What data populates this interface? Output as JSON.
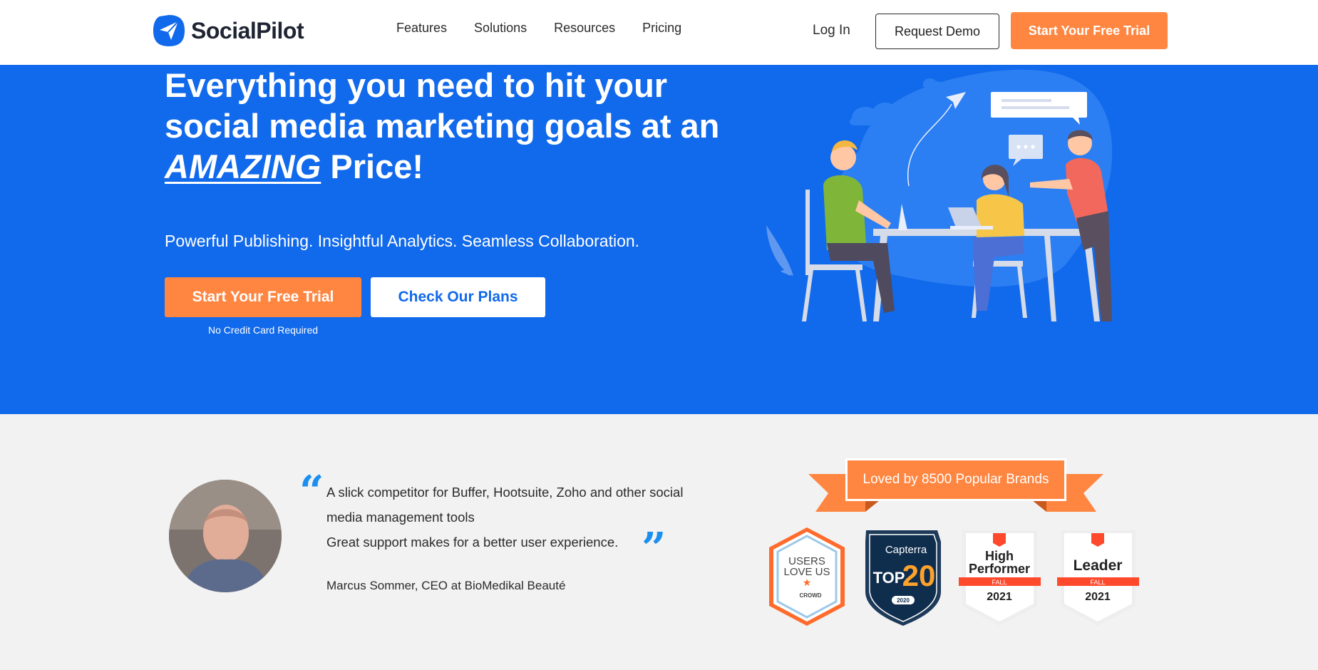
{
  "header": {
    "logo_text": "SocialPilot",
    "nav": [
      "Features",
      "Solutions",
      "Resources",
      "Pricing"
    ],
    "login": "Log In",
    "demo_button": "Request Demo",
    "trial_button": "Start Your Free Trial"
  },
  "hero": {
    "title_line1": "Everything you need to hit your",
    "title_line2": "social media marketing goals at an",
    "title_emph": "AMAZING",
    "title_end": " Price!",
    "subtitle": "Powerful Publishing. Insightful Analytics. Seamless Collaboration.",
    "trial_button": "Start Your Free Trial",
    "plans_button": "Check Our Plans",
    "no_card": "No Credit Card Required"
  },
  "testimonial": {
    "line1": "A slick competitor for Buffer, Hootsuite, Zoho and other social media management tools",
    "line2": "Great support makes for a better user experience.",
    "author": "Marcus Sommer, CEO at BioMedikal Beauté"
  },
  "badges": {
    "ribbon": "Loved by 8500 Popular Brands",
    "items": [
      {
        "top": "USERS",
        "mid": "LOVE US",
        "bottom": "CROWD"
      },
      {
        "top": "Capterra",
        "mid": "TOP",
        "big": "20",
        "bottom": "2020"
      },
      {
        "top": "High",
        "mid": "Performer",
        "band": "FALL",
        "bottom": "2021"
      },
      {
        "top": "Leader",
        "band": "FALL",
        "bottom": "2021"
      }
    ]
  },
  "colors": {
    "brand_blue": "#1169eb",
    "accent_orange": "#ff8641",
    "quote_blue": "#1b8ff0"
  }
}
